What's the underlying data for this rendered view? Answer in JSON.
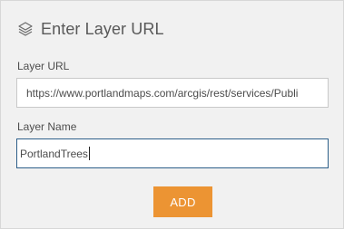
{
  "header": {
    "icon": "layers-icon",
    "title": "Enter Layer URL"
  },
  "layer_url": {
    "label": "Layer URL",
    "value": "https://www.portlandmaps.com/arcgis/rest/services/Publi"
  },
  "layer_name": {
    "label": "Layer Name",
    "value": "PortlandTrees"
  },
  "add_button": {
    "label": "ADD"
  },
  "colors": {
    "panel_background": "#f1f1f1",
    "button_accent": "#ec9433",
    "focus_border": "#2d5f8a"
  }
}
